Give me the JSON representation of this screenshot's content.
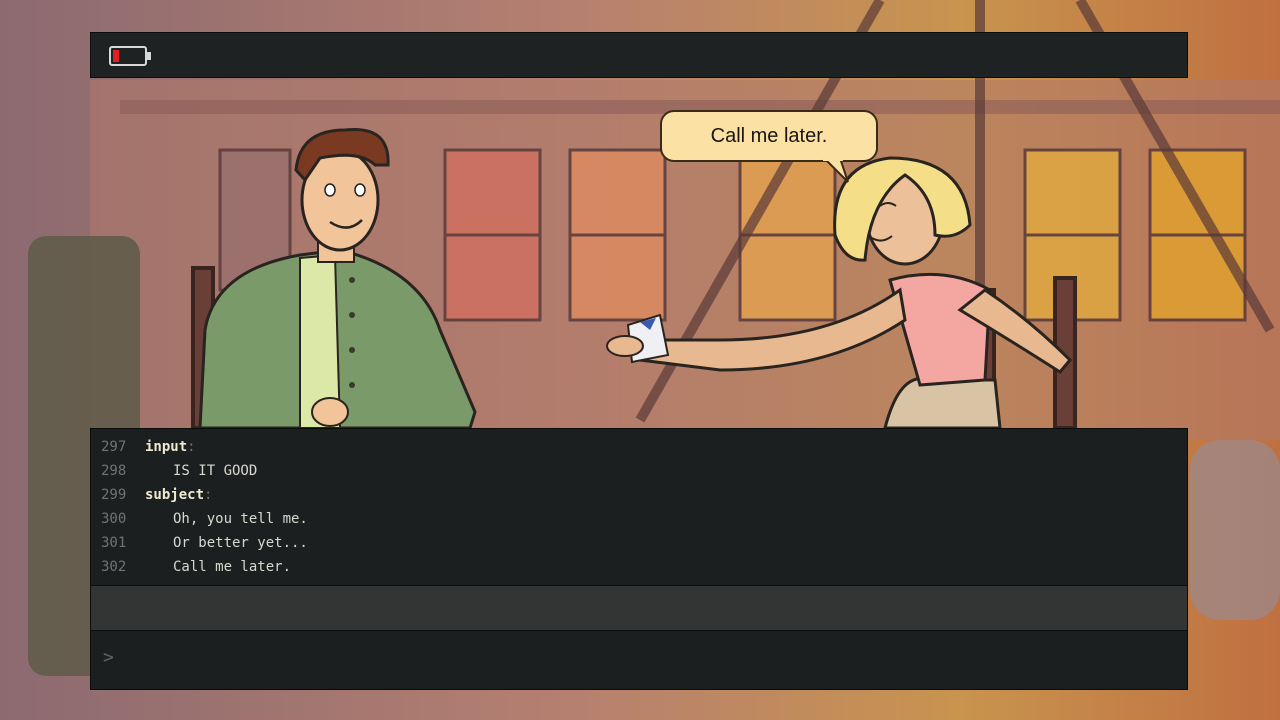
{
  "speech_bubble": {
    "text": "Call me later."
  },
  "console": {
    "lines": [
      {
        "num": "297",
        "key": "input",
        "colon": ":",
        "text": ""
      },
      {
        "num": "298",
        "key": "",
        "colon": "",
        "text": "IS IT GOOD"
      },
      {
        "num": "299",
        "key": "subject",
        "colon": ":",
        "text": ""
      },
      {
        "num": "300",
        "key": "",
        "colon": "",
        "text": "Oh, you tell me."
      },
      {
        "num": "301",
        "key": "",
        "colon": "",
        "text": "Or better yet..."
      },
      {
        "num": "302",
        "key": "",
        "colon": "",
        "text": "Call me later."
      }
    ],
    "prompt_symbol": ">",
    "input_value": ""
  },
  "battery": {
    "level": 0.15,
    "color": "#e02020"
  },
  "colors": {
    "panel_bg": "#1c1f1f",
    "bubble_bg": "#fbe2a4",
    "key_text": "#f0ead0"
  }
}
